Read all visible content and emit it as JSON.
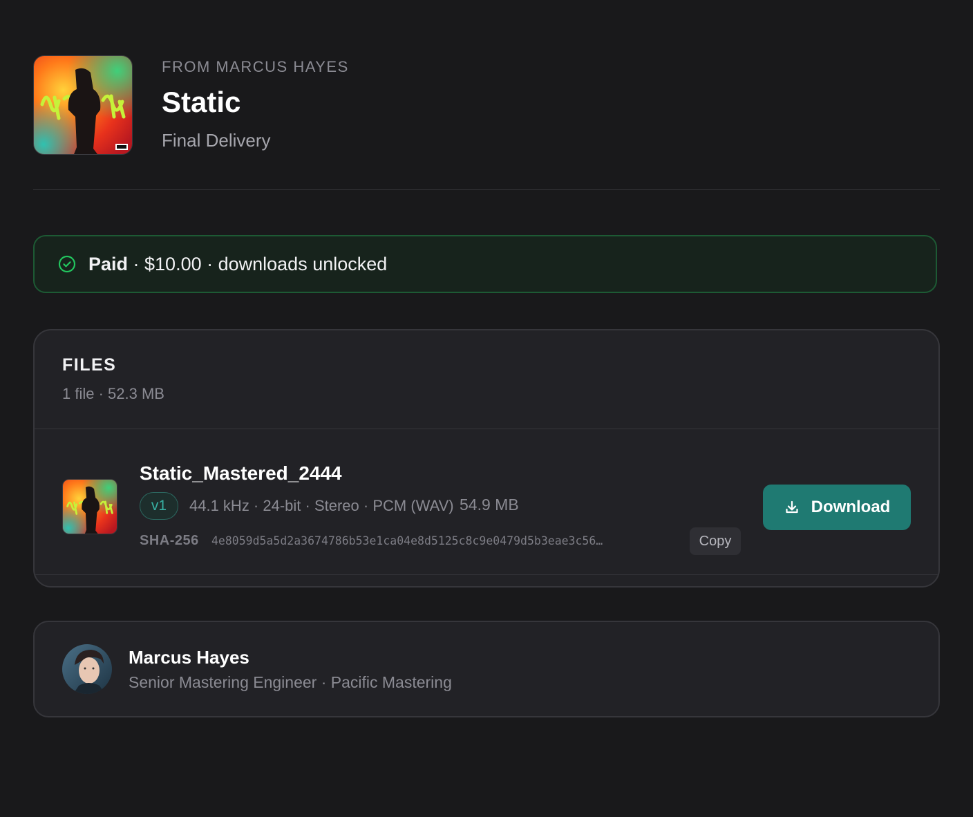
{
  "header": {
    "from": "FROM MARCUS HAYES",
    "title": "Static",
    "subtitle": "Final Delivery"
  },
  "payment": {
    "status": "Paid",
    "details": " · $10.00 · downloads unlocked",
    "accent_color": "#22c55e"
  },
  "files": {
    "label": "FILES",
    "meta": "1 file  ·  52.3 MB",
    "items": [
      {
        "name": "Static_Mastered_2444",
        "version": "v1",
        "specs": "44.1 kHz · 24-bit · Stereo · PCM (WAV)",
        "size": "54.9 MB",
        "sha_label": "SHA-256",
        "sha_value": "4e8059d5a5d2a3674786b53e1ca04e8d5125c8c9e0479d5b3eae3c56…",
        "copy_label": "Copy",
        "download_label": "Download"
      }
    ]
  },
  "contact": {
    "name": "Marcus Hayes",
    "role": "Senior Mastering Engineer · Pacific Mastering"
  },
  "colors": {
    "background": "#19191b",
    "card": "#222226",
    "download_button": "#1f7a72"
  }
}
